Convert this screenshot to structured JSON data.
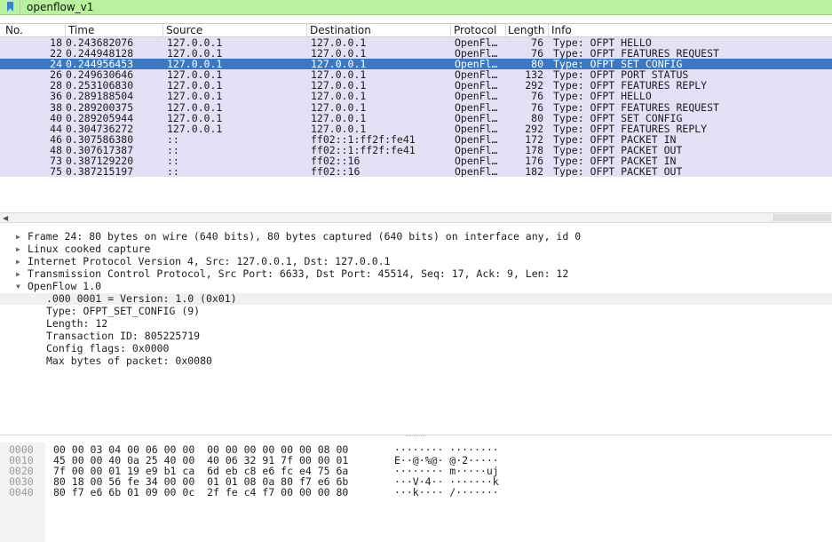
{
  "filter": {
    "text": "openflow_v1"
  },
  "columns": [
    "No.",
    "Time",
    "Source",
    "Destination",
    "Protocol",
    "Length",
    "Info"
  ],
  "packets": [
    {
      "no": "18",
      "time": "0.243682076",
      "src": "127.0.0.1",
      "dst": "127.0.0.1",
      "proto": "OpenFl…",
      "len": "76",
      "info": "Type: OFPT_HELLO"
    },
    {
      "no": "22",
      "time": "0.244948128",
      "src": "127.0.0.1",
      "dst": "127.0.0.1",
      "proto": "OpenFl…",
      "len": "76",
      "info": "Type: OFPT_FEATURES_REQUEST"
    },
    {
      "no": "24",
      "time": "0.244956453",
      "src": "127.0.0.1",
      "dst": "127.0.0.1",
      "proto": "OpenFl…",
      "len": "80",
      "info": "Type: OFPT_SET_CONFIG"
    },
    {
      "no": "26",
      "time": "0.249630646",
      "src": "127.0.0.1",
      "dst": "127.0.0.1",
      "proto": "OpenFl…",
      "len": "132",
      "info": "Type: OFPT_PORT_STATUS"
    },
    {
      "no": "28",
      "time": "0.253106830",
      "src": "127.0.0.1",
      "dst": "127.0.0.1",
      "proto": "OpenFl…",
      "len": "292",
      "info": "Type: OFPT_FEATURES_REPLY"
    },
    {
      "no": "36",
      "time": "0.289188504",
      "src": "127.0.0.1",
      "dst": "127.0.0.1",
      "proto": "OpenFl…",
      "len": "76",
      "info": "Type: OFPT_HELLO"
    },
    {
      "no": "38",
      "time": "0.289200375",
      "src": "127.0.0.1",
      "dst": "127.0.0.1",
      "proto": "OpenFl…",
      "len": "76",
      "info": "Type: OFPT_FEATURES_REQUEST"
    },
    {
      "no": "40",
      "time": "0.289205944",
      "src": "127.0.0.1",
      "dst": "127.0.0.1",
      "proto": "OpenFl…",
      "len": "80",
      "info": "Type: OFPT_SET_CONFIG"
    },
    {
      "no": "44",
      "time": "0.304736272",
      "src": "127.0.0.1",
      "dst": "127.0.0.1",
      "proto": "OpenFl…",
      "len": "292",
      "info": "Type: OFPT_FEATURES_REPLY"
    },
    {
      "no": "46",
      "time": "0.307586380",
      "src": "::",
      "dst": "ff02::1:ff2f:fe41",
      "proto": "OpenFl…",
      "len": "172",
      "info": "Type: OFPT_PACKET_IN"
    },
    {
      "no": "48",
      "time": "0.307617387",
      "src": "::",
      "dst": "ff02::1:ff2f:fe41",
      "proto": "OpenFl…",
      "len": "178",
      "info": "Type: OFPT_PACKET_OUT"
    },
    {
      "no": "73",
      "time": "0.387129220",
      "src": "::",
      "dst": "ff02::16",
      "proto": "OpenFl…",
      "len": "176",
      "info": "Type: OFPT_PACKET_IN"
    },
    {
      "no": "75",
      "time": "0.387215197",
      "src": "::",
      "dst": "ff02::16",
      "proto": "OpenFl…",
      "len": "182",
      "info": "Type: OFPT_PACKET_OUT"
    }
  ],
  "selected_no": "24",
  "details": {
    "frame": "Frame 24: 80 bytes on wire (640 bits), 80 bytes captured (640 bits) on interface any, id 0",
    "linux": "Linux cooked capture",
    "ip": "Internet Protocol Version 4, Src: 127.0.0.1, Dst: 127.0.0.1",
    "tcp": "Transmission Control Protocol, Src Port: 6633, Dst Port: 45514, Seq: 17, Ack: 9, Len: 12",
    "openflow": "OpenFlow 1.0",
    "fields": [
      ".000 0001 = Version: 1.0 (0x01)",
      "Type: OFPT_SET_CONFIG (9)",
      "Length: 12",
      "Transaction ID: 805225719",
      "Config flags: 0x0000",
      "Max bytes of packet: 0x0080"
    ]
  },
  "bytes": [
    {
      "offset": "0000",
      "hex": "00 00 03 04 00 06 00 00  00 00 00 00 00 00 08 00",
      "ascii": "········ ········"
    },
    {
      "offset": "0010",
      "hex": "45 00 00 40 0a 25 40 00  40 06 32 91 7f 00 00 01",
      "ascii": "E··@·%@· @·2·····"
    },
    {
      "offset": "0020",
      "hex": "7f 00 00 01 19 e9 b1 ca  6d eb c8 e6 fc e4 75 6a",
      "ascii": "········ m·····uj"
    },
    {
      "offset": "0030",
      "hex": "80 18 00 56 fe 34 00 00  01 01 08 0a 80 f7 e6 6b",
      "ascii": "···V·4·· ·······k"
    },
    {
      "offset": "0040",
      "hex": "80 f7 e6 6b 01 09 00 0c  2f fe c4 f7 00 00 00 80",
      "ascii": "···k···· /·······"
    }
  ],
  "colors": {
    "filter_ok": "#b8f29e",
    "row_bg": "#e5e0f6",
    "selected_bg": "#3a78c4"
  }
}
